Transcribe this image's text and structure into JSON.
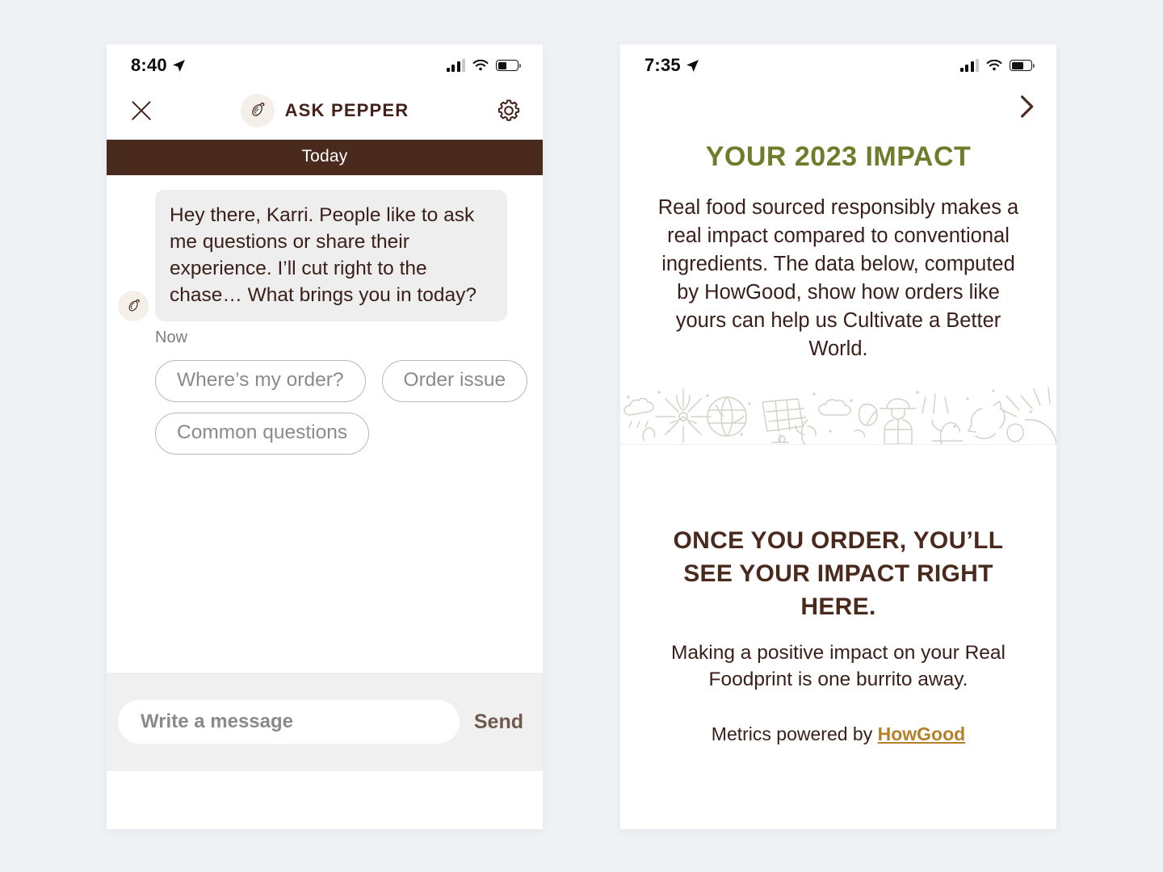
{
  "left_phone": {
    "status_bar": {
      "time": "8:40",
      "location_icon": "location-arrow-icon",
      "signal_icon": "cellular-bars-icon",
      "wifi_icon": "wifi-icon",
      "battery_icon": "battery-icon",
      "battery_level_pct": 45
    },
    "header": {
      "close_label": "close-icon",
      "logo_icon": "pepper-logo-icon",
      "title": "ASK PEPPER",
      "settings_icon": "gear-icon"
    },
    "day_divider": "Today",
    "messages": [
      {
        "avatar_icon": "pepper-avatar-icon",
        "text": "Hey there, Karri. People like to ask me questions or share their experience. I’ll cut right to the chase… What brings you in today?",
        "timestamp": "Now"
      }
    ],
    "quick_replies": [
      "Where’s my order?",
      "Order issue",
      "Common questions"
    ],
    "composer": {
      "placeholder": "Write a message",
      "value": "",
      "send_label": "Send"
    }
  },
  "right_phone": {
    "status_bar": {
      "time": "7:35",
      "location_icon": "location-arrow-icon",
      "signal_icon": "cellular-bars-icon",
      "wifi_icon": "wifi-icon",
      "battery_icon": "battery-icon",
      "battery_level_pct": 62
    },
    "nav": {
      "next_icon": "chevron-right-icon"
    },
    "title": "YOUR 2023 IMPACT",
    "paragraph": "Real food sourced responsibly makes a real impact compared to conventional ingredients. The data below, computed by HowGood, show how orders like yours can help us Cultivate a Better World.",
    "illustration": "sustainability-doodle-band",
    "subtitle": "ONCE YOU ORDER, YOU’LL SEE YOUR IMPACT RIGHT HERE.",
    "note": "Making a positive impact on your Real Foodprint is one burrito away.",
    "credit_prefix": "Metrics powered by",
    "credit_link": "HowGood"
  },
  "colors": {
    "page_background": "#eef2f5",
    "brand_brown": "#4b2a1e",
    "text_brown": "#3a201a",
    "accent_green": "#6e7d2c",
    "link_gold": "#b4812a",
    "bubble_grey": "#eeeeee",
    "chip_border": "#b8b8b8",
    "composer_bg": "#f0f0f0"
  }
}
